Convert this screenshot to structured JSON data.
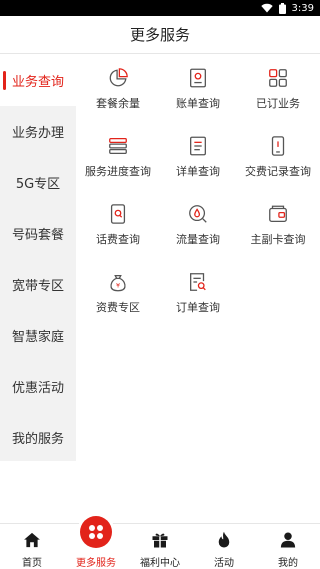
{
  "status_bar": {
    "time": "3:39",
    "wifi_icon": "wifi-icon",
    "battery_icon": "battery-icon"
  },
  "header": {
    "title": "更多服务"
  },
  "sidebar": {
    "items": [
      {
        "label": "业务查询",
        "active": true
      },
      {
        "label": "业务办理"
      },
      {
        "label": "5G专区"
      },
      {
        "label": "号码套餐"
      },
      {
        "label": "宽带专区"
      },
      {
        "label": "智慧家庭"
      },
      {
        "label": "优惠活动"
      },
      {
        "label": "我的服务"
      }
    ]
  },
  "services": [
    {
      "label": "套餐余量",
      "icon": "pie-chart-icon"
    },
    {
      "label": "账单查询",
      "icon": "bill-icon"
    },
    {
      "label": "已订业务",
      "icon": "grid-apps-icon"
    },
    {
      "label": "服务进度查询",
      "icon": "progress-stack-icon"
    },
    {
      "label": "详单查询",
      "icon": "document-list-icon"
    },
    {
      "label": "交费记录查询",
      "icon": "phone-record-icon"
    },
    {
      "label": "话费查询",
      "icon": "phone-search-icon"
    },
    {
      "label": "流量查询",
      "icon": "data-search-icon"
    },
    {
      "label": "主副卡查询",
      "icon": "card-wallet-icon"
    },
    {
      "label": "资费专区",
      "icon": "money-bag-icon"
    },
    {
      "label": "订单查询",
      "icon": "order-search-icon"
    }
  ],
  "bottom_nav": {
    "items": [
      {
        "label": "首页",
        "icon": "home-icon"
      },
      {
        "label": "更多服务",
        "icon": "more-services-icon",
        "active": true
      },
      {
        "label": "福利中心",
        "icon": "gift-icon"
      },
      {
        "label": "活动",
        "icon": "flame-icon"
      },
      {
        "label": "我的",
        "icon": "user-icon"
      }
    ]
  },
  "colors": {
    "accent": "#e2231a",
    "sidebar_bg": "#f2f2f2",
    "icon_grey": "#555555"
  }
}
